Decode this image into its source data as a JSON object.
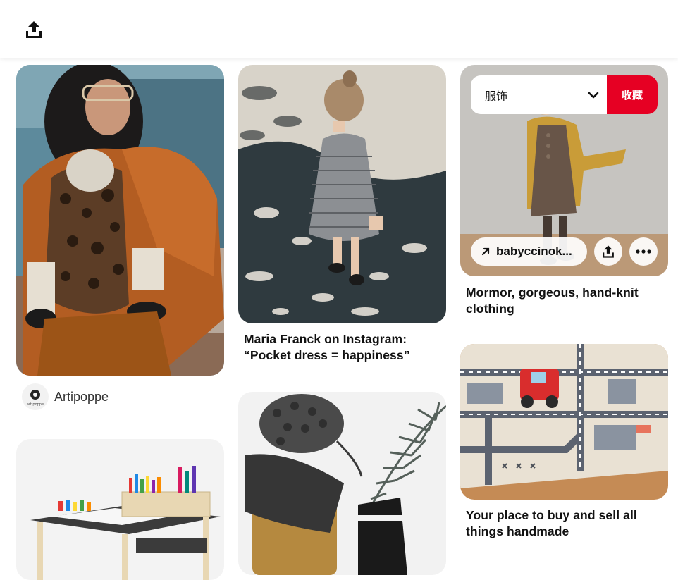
{
  "header": {
    "share_icon": "share-upload-icon"
  },
  "pins": [
    {
      "author": {
        "name": "Artipoppe",
        "avatar_text": "artipoppe"
      }
    },
    {
      "title": "Maria Franck on Instagram: “Pocket dress = happiness”"
    },
    {
      "title": "Mormor, gorgeous, hand-knit clothing"
    },
    {
      "title": "Your place to buy and sell all things handmade"
    }
  ],
  "hover_overlay": {
    "board_name": "服饰",
    "save_label": "收藏",
    "link_label": "babyccinok...",
    "icons": [
      "chevron-down-icon",
      "arrow-up-right-icon",
      "share-upload-icon",
      "more-dots-icon"
    ]
  },
  "colors": {
    "save_button": "#e60023",
    "background": "#ffffff"
  }
}
